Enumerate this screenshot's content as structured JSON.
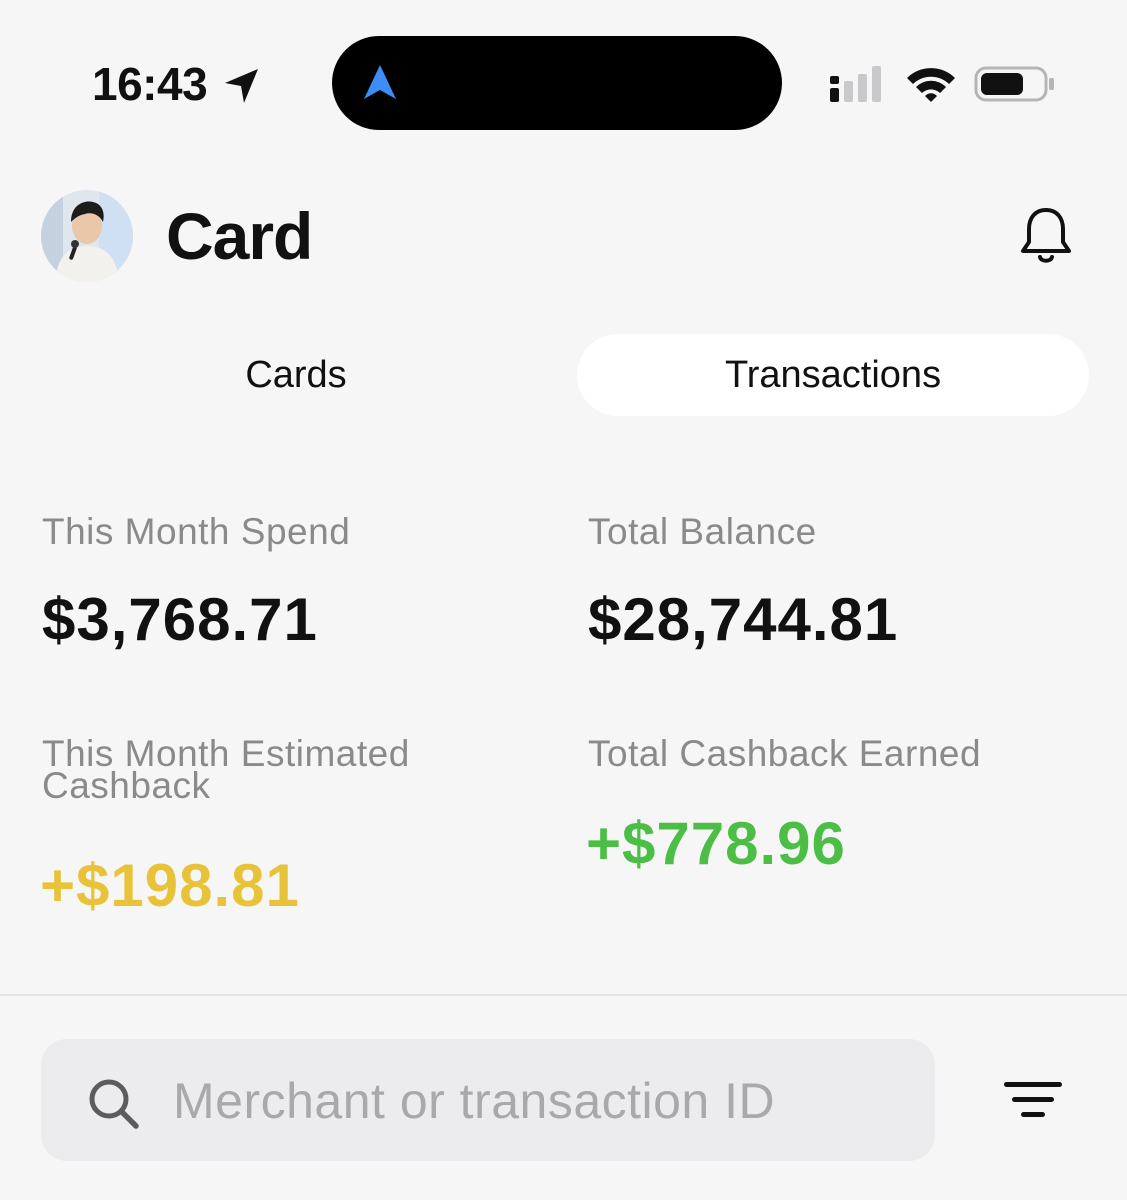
{
  "status_bar": {
    "time": "16:43"
  },
  "header": {
    "title": "Card",
    "avatar_icon": "user-avatar",
    "notification_icon": "bell-icon"
  },
  "tabs": [
    {
      "label": "Cards",
      "selected": false
    },
    {
      "label": "Transactions",
      "selected": true
    }
  ],
  "stats": {
    "month_spend": {
      "label": "This Month Spend",
      "value": "$3,768.71"
    },
    "total_balance": {
      "label": "Total Balance",
      "value": "$28,744.81"
    },
    "estimated_cashback": {
      "label": "This Month Estimated Cashback",
      "value": "+$198.81",
      "color": "#e8c33a"
    },
    "total_cashback": {
      "label": "Total Cashback Earned",
      "value": "+$778.96",
      "color": "#4cbd45"
    }
  },
  "search": {
    "placeholder": "Merchant or transaction ID",
    "value": "",
    "icon": "search-icon"
  },
  "filter": {
    "icon": "filter-icon"
  },
  "colors": {
    "background": "#f6f6f7",
    "selected_tab": "#ffffff",
    "search_background": "#ececee",
    "navigation_arrow": "#3d8cf7"
  }
}
